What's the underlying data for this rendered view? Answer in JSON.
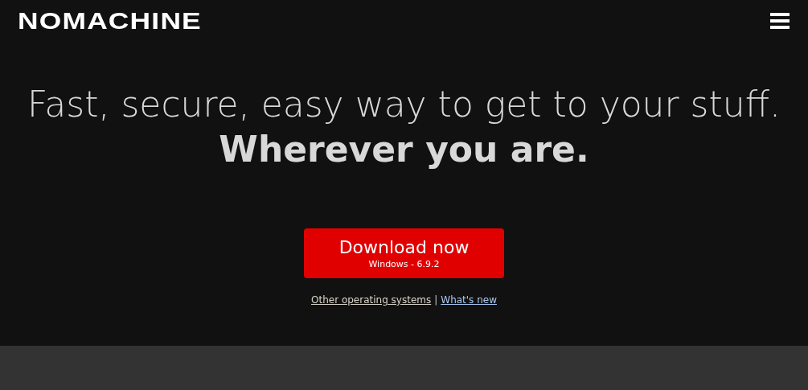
{
  "header": {
    "logo": "NOMACHINE"
  },
  "hero": {
    "headline": "Fast, secure, easy way to get to your stuff.",
    "subheadline": "Wherever you are."
  },
  "download": {
    "label": "Download now",
    "version": "Windows - 6.9.2"
  },
  "links": [
    {
      "label": "Other operating systems",
      "color": "#d8d4c8"
    },
    {
      "label": "What's new",
      "color": "#a8c8f0"
    }
  ],
  "separator": "|"
}
